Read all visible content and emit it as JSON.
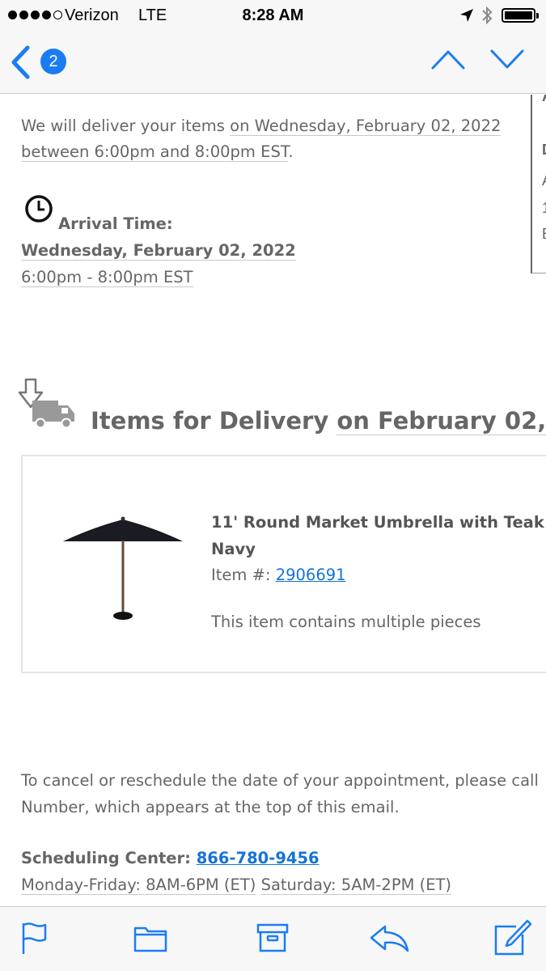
{
  "status_bar": {
    "carrier": "Verizon",
    "network": "LTE",
    "time": "8:28 AM",
    "icons": [
      "location-arrow-icon",
      "bluetooth-icon",
      "battery-icon"
    ]
  },
  "nav": {
    "back_count": "2",
    "icons": [
      "back-chevron-icon",
      "previous-message-icon",
      "next-message-icon"
    ],
    "accent_color": "#1a7cf3"
  },
  "email": {
    "intro_line1_prefix": "We will deliver your items ",
    "intro_line1_date": "on Wednesday, February 02, 2022",
    "intro_line2_window": "between 6:00pm and 8:00pm EST",
    "intro_line2_suffix": ".",
    "arrival_label": "Arrival Time:",
    "arrival_date": "Wednesday, February 02, 2022",
    "arrival_window": "6:00pm - 8:00pm EST",
    "items_heading_prefix": "Items for Delivery ",
    "items_heading_date": "on February 02,",
    "right_panel_chars": [
      "A",
      "D",
      "A",
      "1",
      "E"
    ],
    "product": {
      "name_line1": "11' Round Market Umbrella with Teak",
      "name_line2": "Navy",
      "item_label": "Item #: ",
      "item_number": "2906691",
      "note": "This item contains multiple pieces"
    },
    "cancel_line1": "To cancel or reschedule the date of your appointment, please call",
    "cancel_line2": "Number, which appears at the top of this email.",
    "scheduling_label": "Scheduling Center: ",
    "scheduling_phone": "866-780-9456",
    "hours_weekday": "Monday-Friday: 8AM-6PM (ET)",
    "hours_saturday": "Saturday: 5AM-2PM (ET)"
  },
  "toolbar": {
    "icons": [
      "flag-icon",
      "folder-icon",
      "archive-icon",
      "reply-icon",
      "compose-icon"
    ]
  },
  "colors": {
    "link": "#1673d6",
    "body_text": "#666666",
    "ios_blue": "#1a7cf3"
  }
}
